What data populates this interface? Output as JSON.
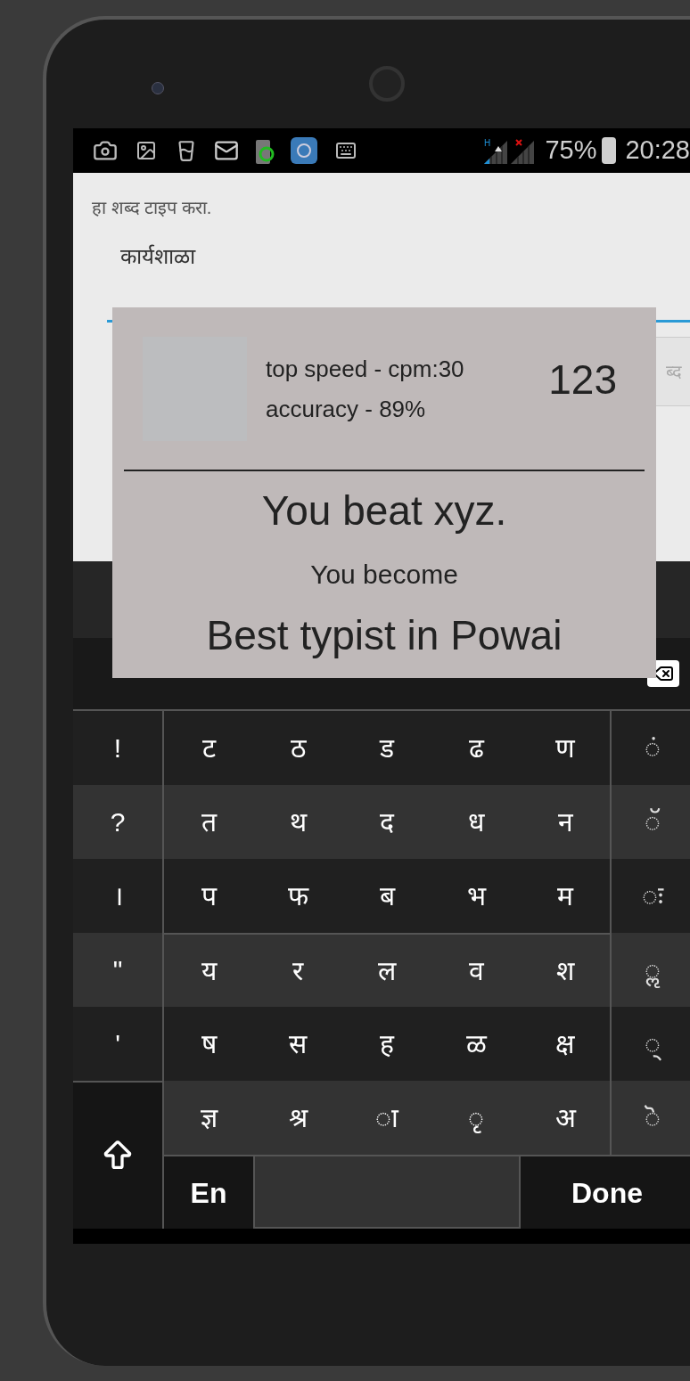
{
  "status_bar": {
    "network": "H",
    "battery": "75%",
    "time": "20:28"
  },
  "prompt": "हा शब्द टाइप करा.",
  "word": "कार्यशाळा",
  "input": {
    "placeholder": "ब्द"
  },
  "dialog": {
    "speed": "top speed - cpm:30",
    "accuracy": "accuracy - 89%",
    "score": "123",
    "headline": "You beat xyz.",
    "subline": "You become",
    "title": "Best typist in Powai"
  },
  "keyboard": {
    "rows": [
      {
        "left": "!",
        "keys": [
          "ट",
          "ठ",
          "ड",
          "ढ",
          "ण"
        ],
        "right": "◌ं"
      },
      {
        "left": "?",
        "keys": [
          "त",
          "थ",
          "द",
          "ध",
          "न"
        ],
        "right": "◌ॅ"
      },
      {
        "left": "।",
        "keys": [
          "प",
          "फ",
          "ब",
          "भ",
          "म"
        ],
        "right": "◌ः"
      },
      {
        "left": "\"",
        "keys": [
          "य",
          "र",
          "ल",
          "व",
          "श"
        ],
        "right": "◌ॢ"
      },
      {
        "left": "'",
        "keys": [
          "ष",
          "स",
          "ह",
          "ळ",
          "क्ष"
        ],
        "right": "◌्"
      },
      {
        "keys": [
          "ज्ञ",
          "श्र",
          "◌ा",
          "◌ृ",
          "अ"
        ],
        "right": "◌ॆ"
      }
    ],
    "language_key": "En",
    "done_key": "Done"
  }
}
